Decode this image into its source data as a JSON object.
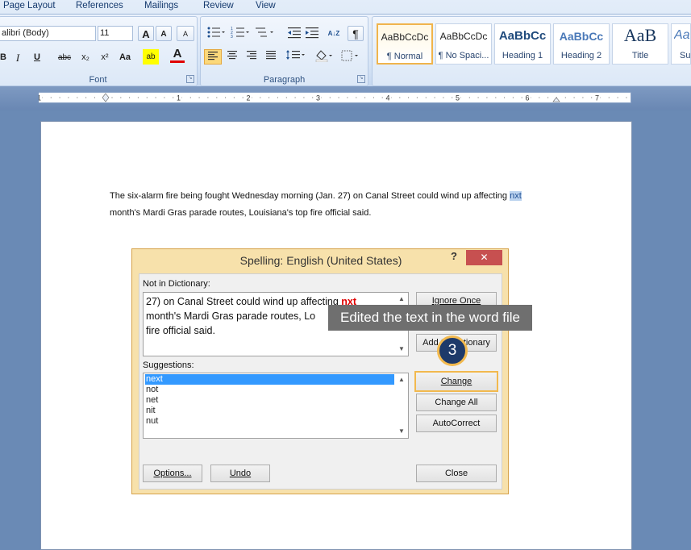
{
  "ribbon": {
    "tabs": [
      "Page Layout",
      "References",
      "Mailings",
      "Review",
      "View"
    ],
    "font": {
      "family": "alibri (Body)",
      "size": "11",
      "group_label": "Font",
      "grow_label": "A",
      "shrink_label": "A",
      "clear_label": "A",
      "bold": "B",
      "italic": "I",
      "underline": "U",
      "strike": "abc",
      "subscript": "x₂",
      "superscript": "x²",
      "change_case": "Aa",
      "highlight_label": "ab",
      "font_color_label": "A"
    },
    "paragraph": {
      "group_label": "Paragraph",
      "pilcrow": "¶",
      "sort": "A↓Z"
    },
    "styles": [
      {
        "sample": "AaBbCcDc",
        "name": "¶ Normal"
      },
      {
        "sample": "AaBbCcDc",
        "name": "¶ No Spaci..."
      },
      {
        "sample": "AaBbCc",
        "name": "Heading 1"
      },
      {
        "sample": "AaBbCc",
        "name": "Heading 2"
      },
      {
        "sample": "AaB",
        "name": "Title"
      },
      {
        "sample": "AaB",
        "name": "Su"
      }
    ]
  },
  "ruler": {
    "numbers": [
      "1",
      "1",
      "2",
      "3",
      "4",
      "5",
      "6",
      "7"
    ]
  },
  "document": {
    "line1_prefix": "The six-alarm fire being fought Wednesday morning (Jan. 27) on Canal Street could wind up affecting ",
    "line1_word": "nxt",
    "line2": "month's Mardi Gras parade routes, Louisiana's top fire official said."
  },
  "dialog": {
    "title": "Spelling: English (United States)",
    "help": "?",
    "close": "✕",
    "not_in_dict_label": "Not in Dictionary:",
    "context_line1_prefix": "27) on Canal Street could wind up affecting ",
    "context_word": "nxt",
    "context_line2": "month's Mardi Gras parade routes, Lo",
    "context_line3": "fire official said.",
    "suggestions_label": "Suggestions:",
    "suggestions": [
      "next",
      "not",
      "net",
      "nit",
      "nut"
    ],
    "buttons": {
      "ignore_once": "Ignore Once",
      "add": "Add to Dictionary",
      "change": "Change",
      "change_all": "Change All",
      "autocorrect": "AutoCorrect",
      "options": "Options...",
      "undo": "Undo",
      "close": "Close"
    },
    "colors": {
      "error_word": "#e00000",
      "highlight": "#3399ff",
      "accent": "#f2b94e"
    }
  },
  "overlay": {
    "tooltip": "Edited the text in the word file",
    "step": "3"
  }
}
